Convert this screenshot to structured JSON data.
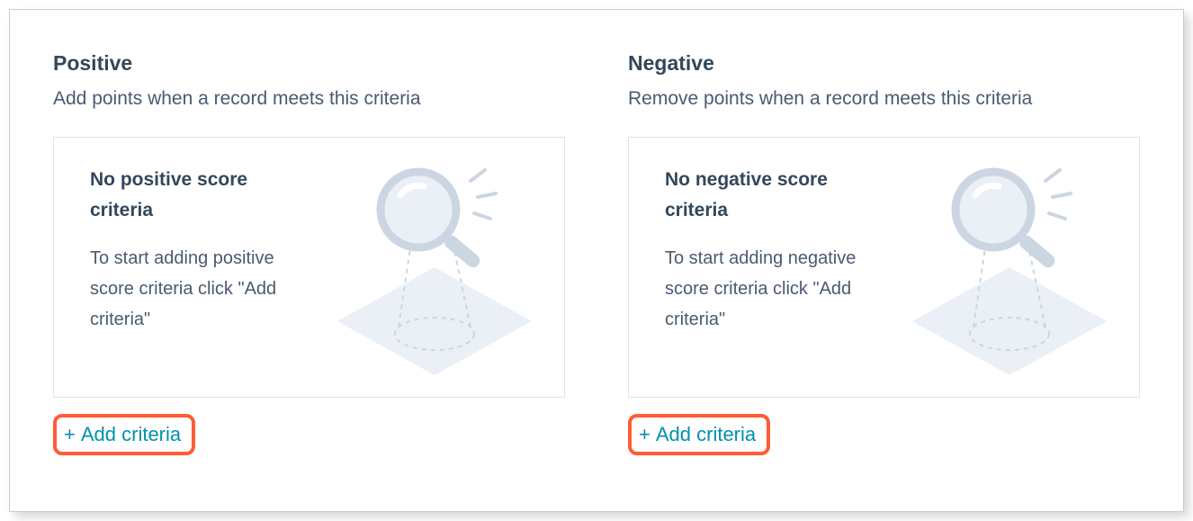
{
  "positive": {
    "title": "Positive",
    "subtitle": "Add points when a record meets this criteria",
    "card_heading": "No positive score criteria",
    "card_desc": "To start adding positive score criteria click \"Add criteria\"",
    "add_label": "Add criteria"
  },
  "negative": {
    "title": "Negative",
    "subtitle": "Remove points when a record meets this criteria",
    "card_heading": "No negative score criteria",
    "card_desc": "To start adding negative score criteria click \"Add criteria\"",
    "add_label": "Add criteria"
  },
  "colors": {
    "text": "#33475b",
    "accent": "#0091ae",
    "highlight": "#ff5c35",
    "illus_fill": "#eaf0f6",
    "illus_stroke": "#cbd6e2"
  }
}
